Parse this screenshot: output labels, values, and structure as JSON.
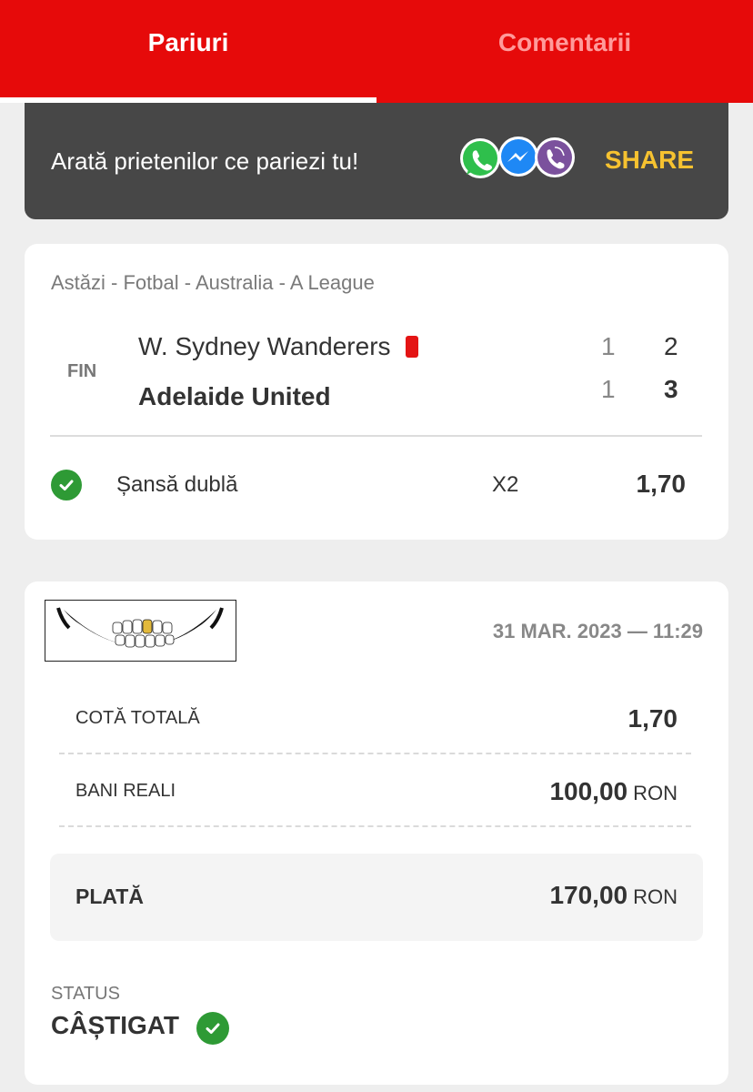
{
  "tabs": [
    {
      "label": "Pariuri",
      "active": true
    },
    {
      "label": "Comentarii",
      "active": false
    }
  ],
  "share": {
    "text": "Arată prietenilor ce pariezi tu!",
    "button": "SHARE",
    "icons": [
      "whatsapp-icon",
      "messenger-icon",
      "viber-icon"
    ]
  },
  "match": {
    "breadcrumb": "Astăzi - Fotbal - Australia - A League",
    "status": "FIN",
    "home": {
      "name": "W. Sydney Wanderers",
      "ht": "1",
      "ft": "2"
    },
    "away": {
      "name": "Adelaide United",
      "ht": "1",
      "ft": "3"
    },
    "market": "Șansă dublă",
    "selection": "X2",
    "odd": "1,70"
  },
  "ticket": {
    "date": "31 MAR. 2023 — 11:29",
    "total_odds_label": "COTĂ TOTALĂ",
    "total_odds": "1,70",
    "stake_label": "BANI REALI",
    "stake": "100,00",
    "currency": "RON",
    "payout_label": "PLATĂ",
    "payout": "170,00",
    "status_label": "STATUS",
    "status": "CÂȘTIGAT"
  },
  "colors": {
    "brand_red": "#e60a0a",
    "share_yellow": "#f6c230",
    "banner_dark": "#474747",
    "success_green": "#2e9a35"
  }
}
